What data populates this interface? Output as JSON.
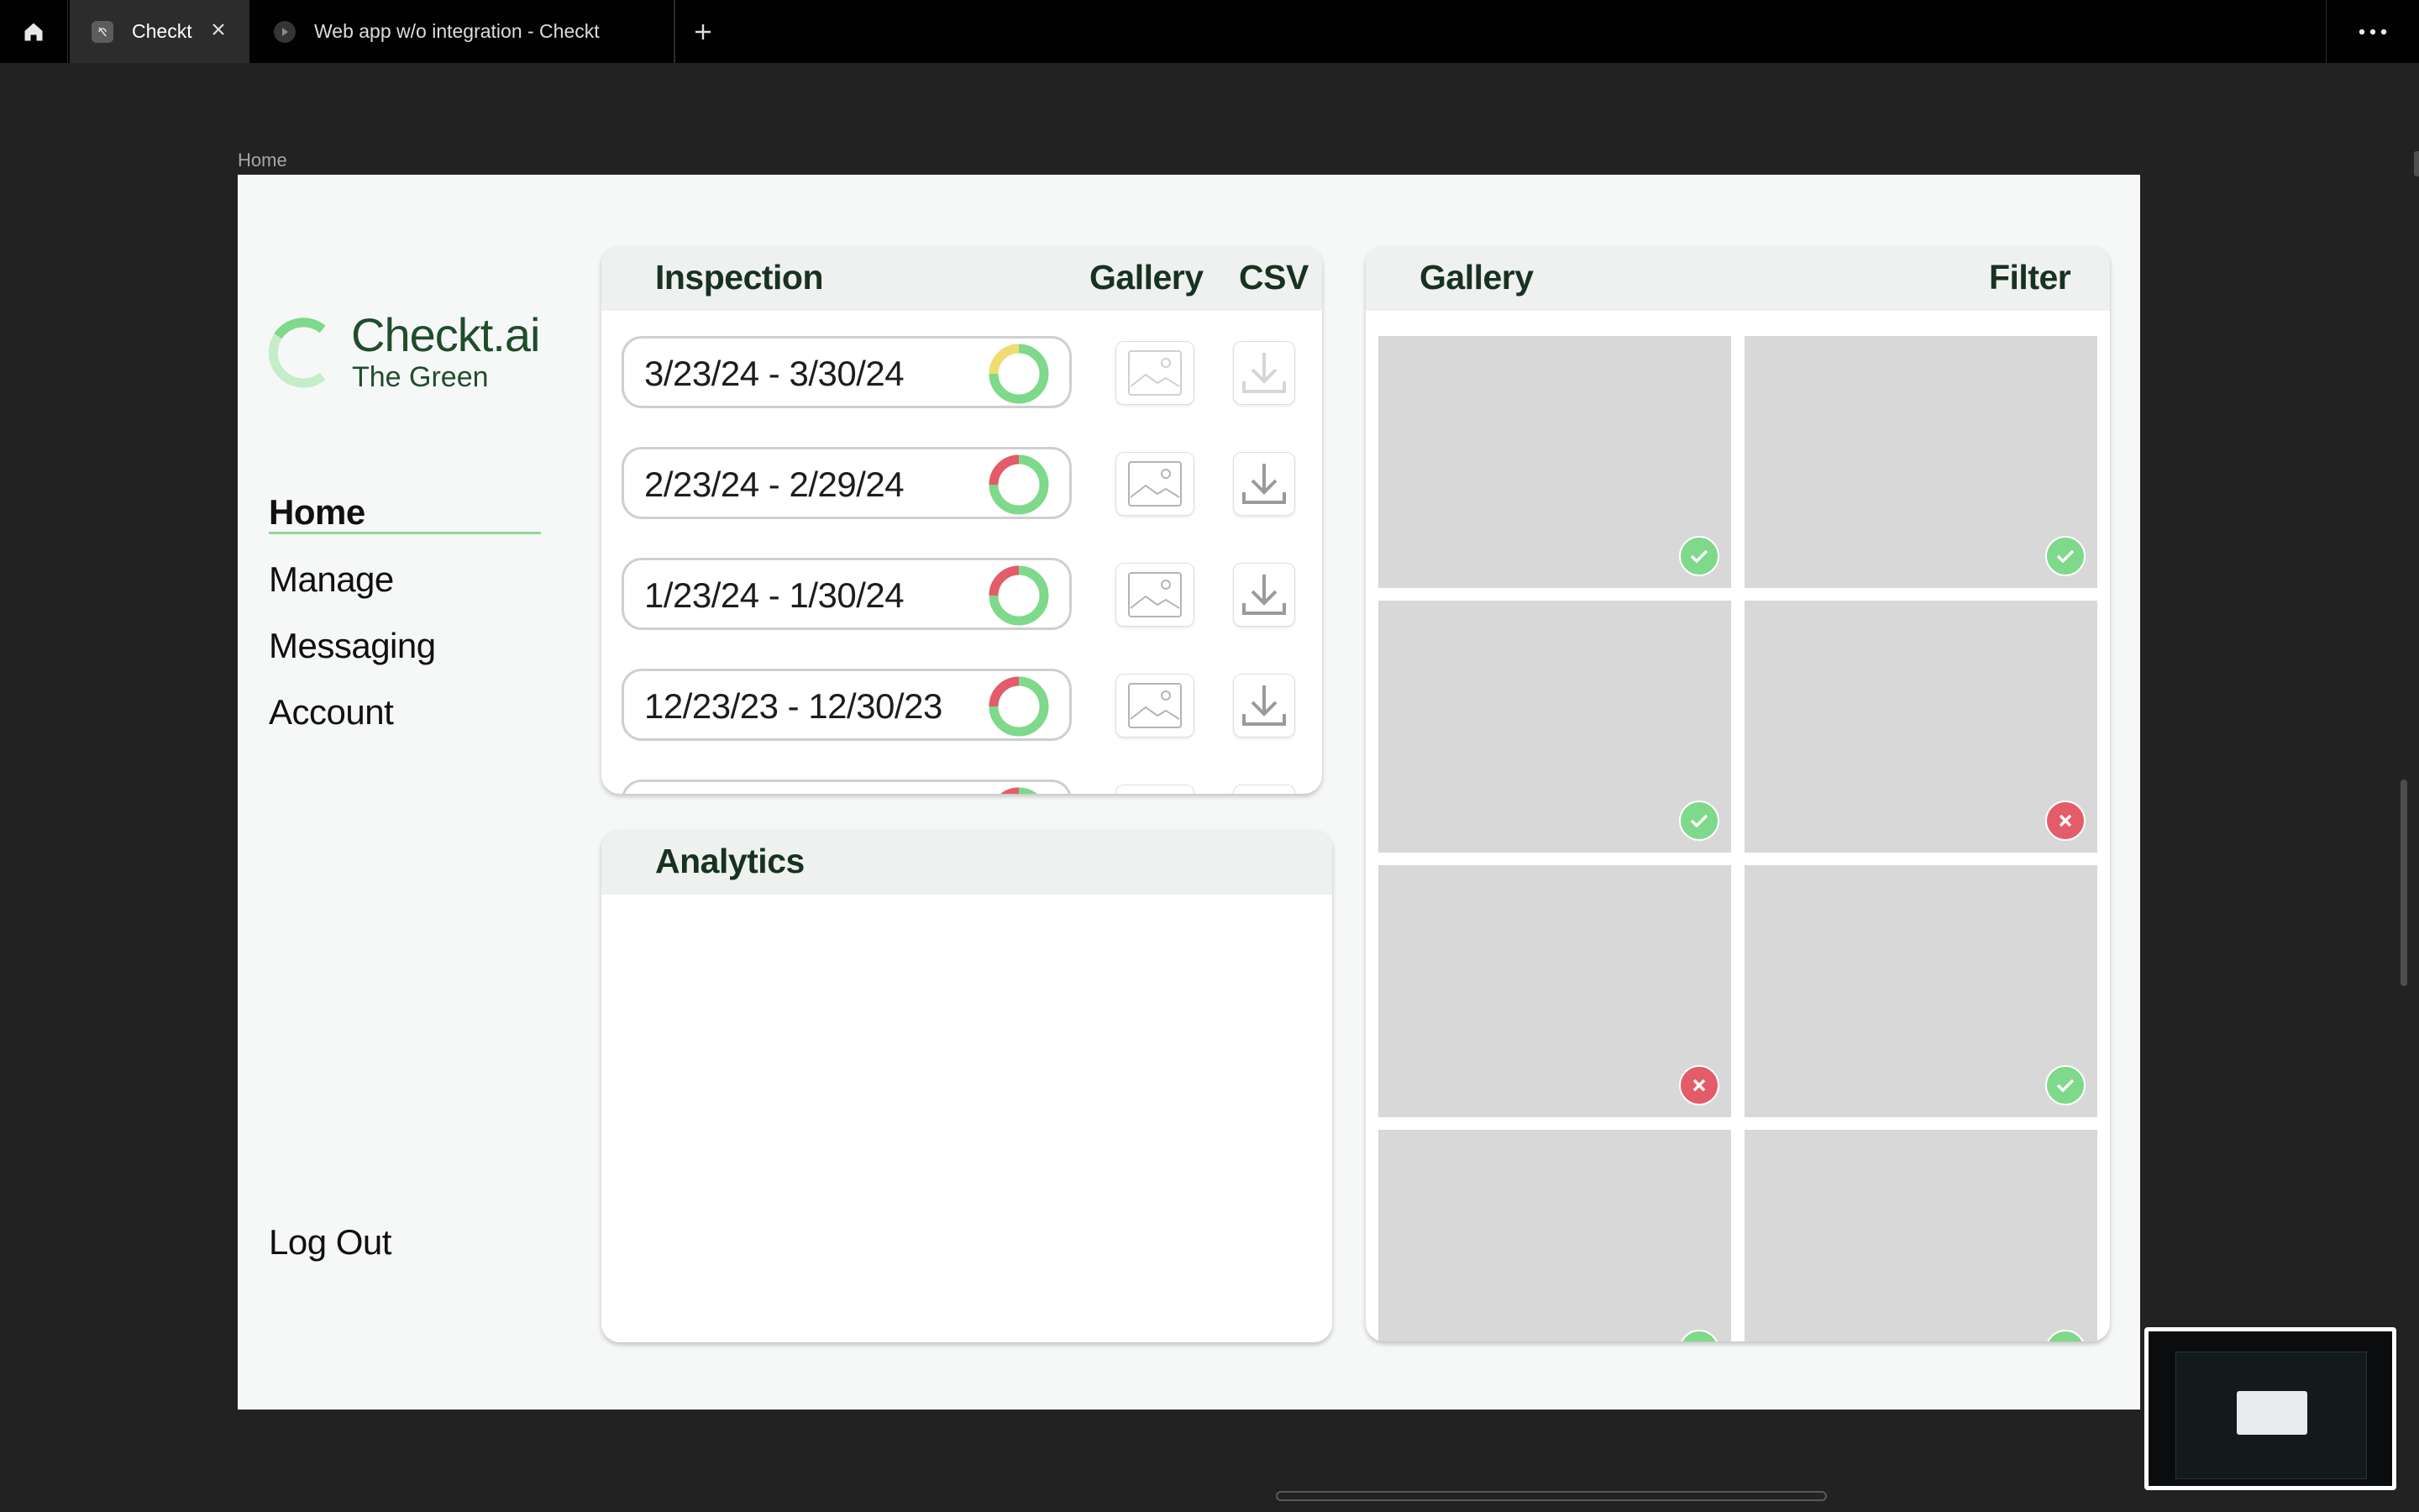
{
  "browser": {
    "tabs": [
      {
        "title": "Checkt",
        "active": true
      },
      {
        "title": "Web app w/o integration - Checkt",
        "active": false
      }
    ]
  },
  "breadcrumb": "Home",
  "brand": {
    "name": "Checkt.ai",
    "location": "The Green",
    "accent": "#7ed98a"
  },
  "nav": {
    "items": [
      {
        "label": "Home",
        "active": true
      },
      {
        "label": "Manage",
        "active": false
      },
      {
        "label": "Messaging",
        "active": false
      },
      {
        "label": "Account",
        "active": false
      }
    ],
    "logout": "Log Out"
  },
  "inspection_panel": {
    "headers": {
      "inspection": "Inspection",
      "gallery": "Gallery",
      "csv": "CSV"
    },
    "rows": [
      {
        "date_range": "3/23/24 - 3/30/24",
        "status": {
          "pass": 0.75,
          "warn": 0.25,
          "fail": 0
        }
      },
      {
        "date_range": "2/23/24 - 2/29/24",
        "status": {
          "pass": 0.75,
          "warn": 0,
          "fail": 0.25
        }
      },
      {
        "date_range": "1/23/24 - 1/30/24",
        "status": {
          "pass": 0.75,
          "warn": 0,
          "fail": 0.25
        }
      },
      {
        "date_range": "12/23/23 - 12/30/23",
        "status": {
          "pass": 0.75,
          "warn": 0,
          "fail": 0.25
        }
      }
    ]
  },
  "analytics_panel": {
    "title": "Analytics"
  },
  "gallery_panel": {
    "title": "Gallery",
    "filter": "Filter",
    "items": [
      "pass",
      "pass",
      "pass",
      "fail",
      "fail",
      "pass",
      "pass",
      "pass"
    ]
  },
  "colors": {
    "pass": "#7ed98a",
    "fail": "#e45b69",
    "warn": "#f0dd72",
    "heading": "#183221"
  }
}
